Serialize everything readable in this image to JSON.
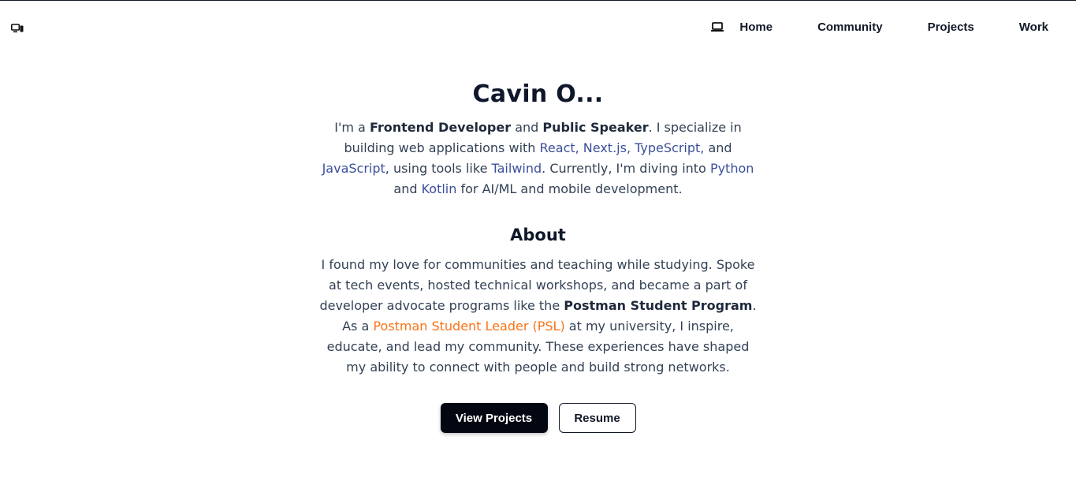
{
  "nav": {
    "logo_icon": "monitor-phone-icon",
    "theme_icon": "laptop-icon",
    "links": [
      "Home",
      "Community",
      "Projects",
      "Work"
    ]
  },
  "hero": {
    "name": "Cavin O...",
    "intro": {
      "t1": "I'm a ",
      "role1": "Frontend Developer",
      "t2": " and ",
      "role2": "Public Speaker",
      "t3": ". I specialize in building web applications with ",
      "tech1": "React, Next.js, TypeScript,",
      "t4": " and ",
      "tech2": "JavaScript",
      "t5": ", using tools like ",
      "tech3": "Tailwind",
      "t6": ". Currently, I'm diving into ",
      "tech4": "Python",
      "t7": " and ",
      "tech5": "Kotlin",
      "t8": " for AI/ML and mobile development."
    },
    "about_title": "About",
    "about": {
      "a1": "I found my love for communities and teaching while studying. Spoke at tech events, hosted technical workshops, and became a part of developer advocate programs like the ",
      "program": "Postman Student Program",
      "a2": ". As a ",
      "psl": "Postman Student Leader (PSL)",
      "a3": " at my university, I inspire, educate, and lead my community. These experiences have shaped my ability to connect with people and build strong networks."
    },
    "buttons": {
      "primary": "View Projects",
      "secondary": "Resume"
    }
  },
  "colors": {
    "tech_link": "#3b4f9a",
    "accent_orange": "#f97316",
    "primary_button": "#030712"
  }
}
